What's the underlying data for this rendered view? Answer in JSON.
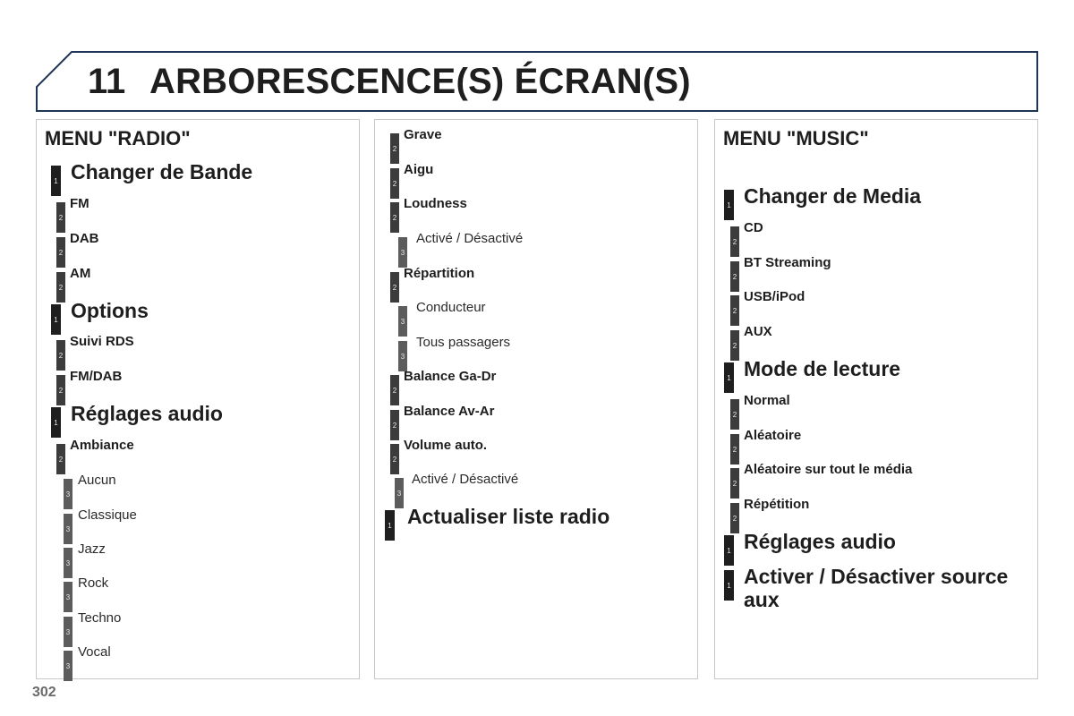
{
  "header": {
    "chapter_number": "11",
    "chapter_title": "ARBORESCENCE(S) ÉCRAN(S)",
    "border_color": "#1f3556"
  },
  "radio_menu": {
    "title": "MENU \"RADIO\"",
    "items": [
      {
        "level": "1",
        "label": "Changer de Bande"
      },
      {
        "level": "2",
        "label": "FM"
      },
      {
        "level": "2",
        "label": "DAB"
      },
      {
        "level": "2",
        "label": "AM"
      },
      {
        "level": "1",
        "label": "Options"
      },
      {
        "level": "2",
        "label": "Suivi RDS"
      },
      {
        "level": "2",
        "label": "FM/DAB"
      },
      {
        "level": "1",
        "label": "Réglages audio"
      },
      {
        "level": "2",
        "label": "Ambiance"
      },
      {
        "level": "3",
        "label": "Aucun"
      },
      {
        "level": "3",
        "label": "Classique"
      },
      {
        "level": "3",
        "label": "Jazz"
      },
      {
        "level": "3",
        "label": "Rock"
      },
      {
        "level": "3",
        "label": "Techno"
      },
      {
        "level": "3",
        "label": "Vocal"
      }
    ]
  },
  "radio_menu_cont": {
    "items": [
      {
        "level": "2",
        "label": "Grave"
      },
      {
        "level": "2",
        "label": "Aigu"
      },
      {
        "level": "2",
        "label": "Loudness"
      },
      {
        "level": "3",
        "label": "Activé / Désactivé"
      },
      {
        "level": "2",
        "label": "Répartition"
      },
      {
        "level": "3",
        "label": "Conducteur"
      },
      {
        "level": "3",
        "label": "Tous passagers"
      },
      {
        "level": "2",
        "label": "Balance Ga-Dr"
      },
      {
        "level": "2",
        "label": "Balance Av-Ar"
      },
      {
        "level": "2",
        "label": "Volume auto."
      },
      {
        "level": "3",
        "label": "Activé / Désactivé"
      },
      {
        "level": "1",
        "label": "Actualiser liste radio"
      }
    ]
  },
  "music_menu": {
    "title": "MENU \"MUSIC\"",
    "items": [
      {
        "level": "1",
        "label": "Changer de Media"
      },
      {
        "level": "2",
        "label": "CD"
      },
      {
        "level": "2",
        "label": "BT Streaming"
      },
      {
        "level": "2",
        "label": "USB/iPod"
      },
      {
        "level": "2",
        "label": "AUX"
      },
      {
        "level": "1",
        "label": "Mode de lecture"
      },
      {
        "level": "2",
        "label": "Normal"
      },
      {
        "level": "2",
        "label": "Aléatoire"
      },
      {
        "level": "2",
        "label": "Aléatoire sur tout le média"
      },
      {
        "level": "2",
        "label": "Répétition"
      },
      {
        "level": "1",
        "label": "Réglages audio"
      },
      {
        "level": "1",
        "label": "Activer / Désactiver source aux"
      }
    ]
  },
  "footer": {
    "page_number": "302"
  }
}
